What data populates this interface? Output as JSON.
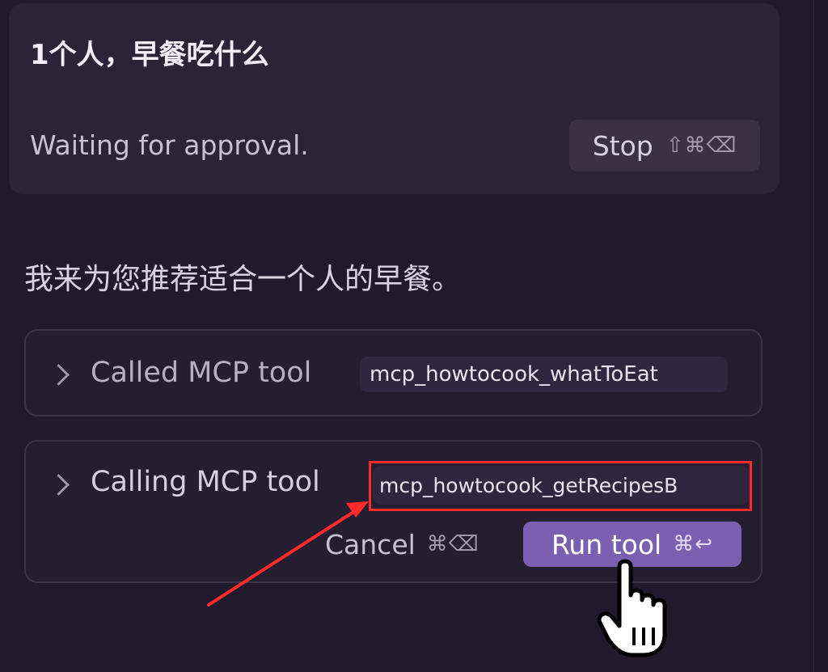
{
  "user_message": {
    "text": "1个人，早餐吃什么",
    "status": "Waiting for approval.",
    "stop_button": {
      "label": "Stop",
      "shortcut": "⇧⌘⌫"
    }
  },
  "assistant": {
    "reply": "我来为您推荐适合一个人的早餐。",
    "tool_calls": [
      {
        "label": "Called MCP tool",
        "tool_name": "mcp_howtocook_whatToEat"
      },
      {
        "label": "Calling MCP tool",
        "tool_name": "mcp_howtocook_getRecipesB",
        "cancel": {
          "label": "Cancel",
          "shortcut": "⌘⌫"
        },
        "run": {
          "label": "Run tool",
          "shortcut": "⌘↩"
        }
      }
    ]
  },
  "colors": {
    "background": "#211a2c",
    "card": "#2b2336",
    "accent": "#7b5fb0",
    "annotation": "#ff2a2a"
  },
  "icons": {
    "tool_toggle": "chevron-right-icon",
    "pointer": "hand-pointer-icon",
    "annotation": "red-arrow"
  }
}
